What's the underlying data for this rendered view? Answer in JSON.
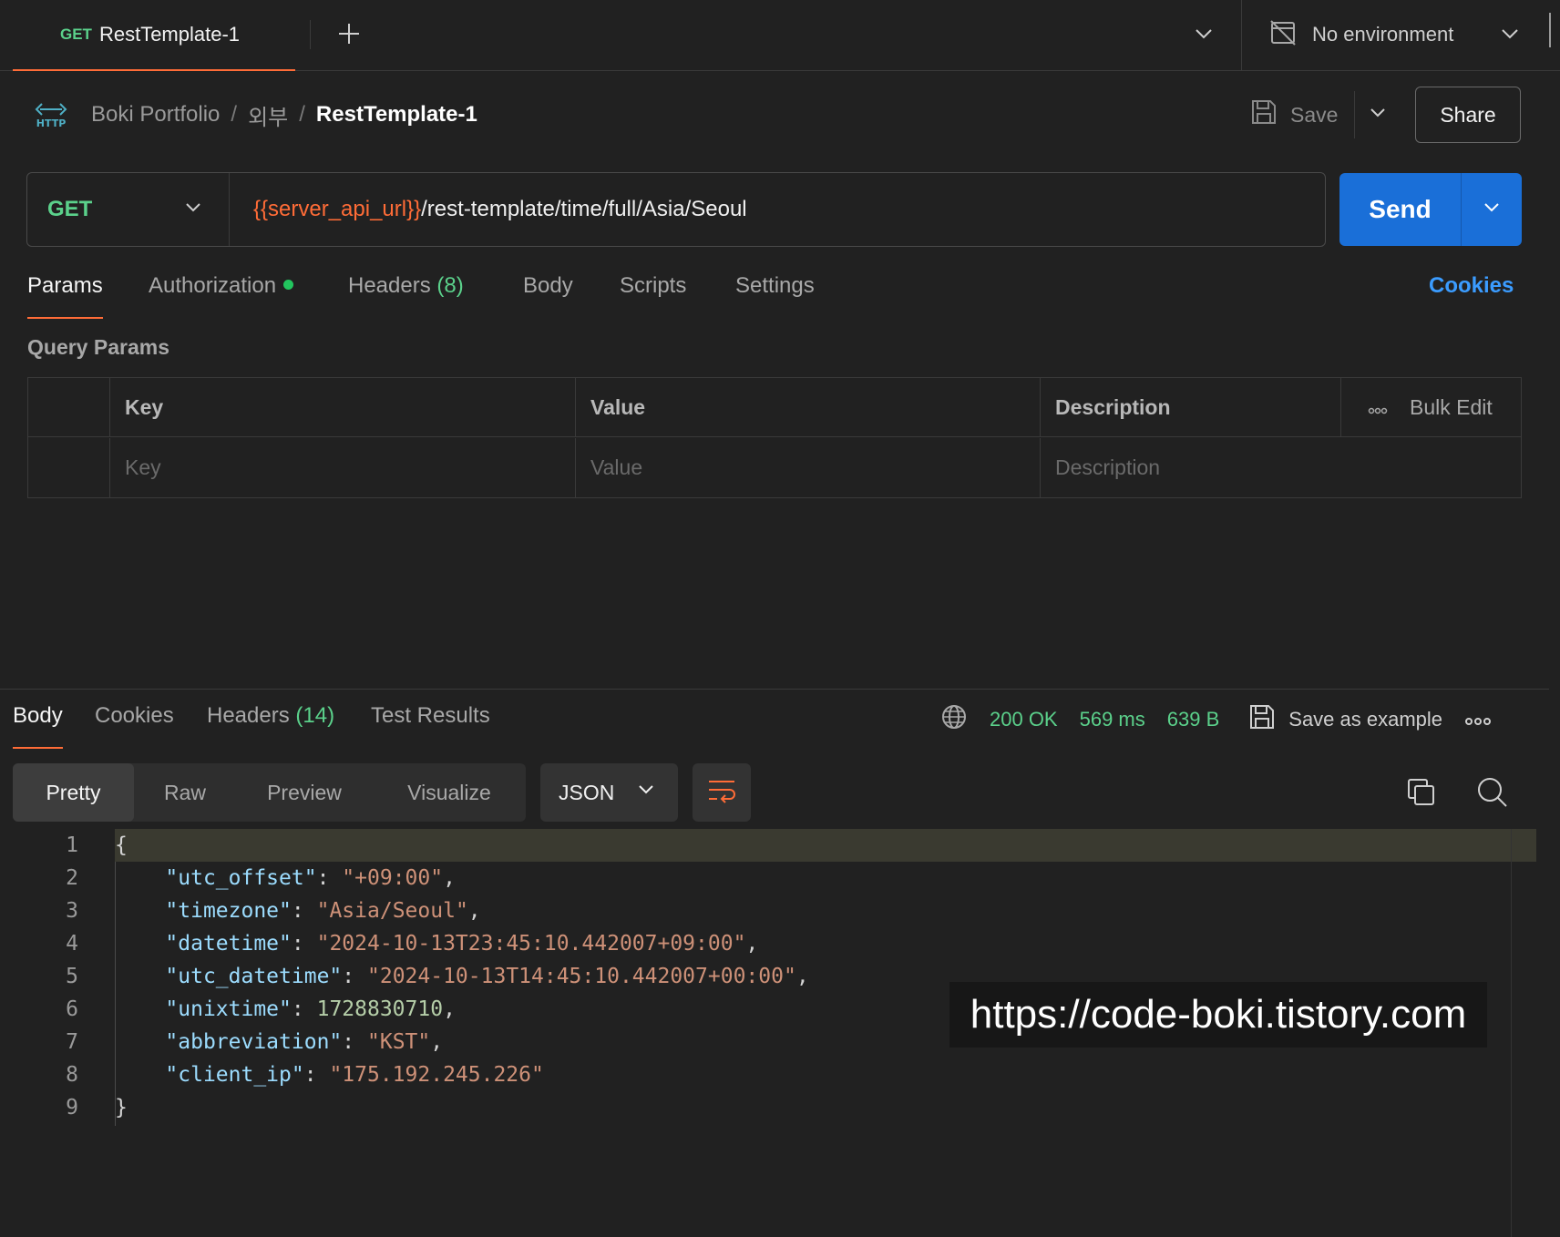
{
  "tab": {
    "method": "GET",
    "title": "RestTemplate-1"
  },
  "environment": {
    "label": "No environment"
  },
  "breadcrumb": {
    "collection": "Boki Portfolio",
    "folder": "외부",
    "request": "RestTemplate-1",
    "separator": "/"
  },
  "header": {
    "save_label": "Save",
    "share_label": "Share"
  },
  "request": {
    "method": "GET",
    "url_variable": "{{server_api_url}}",
    "url_path": "/rest-template/time/full/Asia/Seoul",
    "send_label": "Send"
  },
  "request_tabs": [
    {
      "label": "Params",
      "active": true
    },
    {
      "label": "Authorization",
      "status_dot": true
    },
    {
      "label": "Headers",
      "count": "(8)"
    },
    {
      "label": "Body"
    },
    {
      "label": "Scripts"
    },
    {
      "label": "Settings"
    }
  ],
  "cookies_link": "Cookies",
  "query_params": {
    "title": "Query Params",
    "columns": {
      "key": "Key",
      "value": "Value",
      "description": "Description"
    },
    "bulk_edit": "Bulk Edit",
    "placeholders": {
      "key": "Key",
      "value": "Value",
      "description": "Description"
    }
  },
  "response_tabs": [
    {
      "label": "Body",
      "active": true
    },
    {
      "label": "Cookies"
    },
    {
      "label": "Headers",
      "count": "(14)"
    },
    {
      "label": "Test Results"
    }
  ],
  "response_meta": {
    "status": "200 OK",
    "time": "569 ms",
    "size": "639 B",
    "save_example": "Save as example"
  },
  "view_modes": [
    "Pretty",
    "Raw",
    "Preview",
    "Visualize"
  ],
  "active_view_mode": "Pretty",
  "format": "JSON",
  "response_body": {
    "line_numbers": [
      "1",
      "2",
      "3",
      "4",
      "5",
      "6",
      "7",
      "8",
      "9"
    ],
    "open_brace": "{",
    "close_brace": "}",
    "fields": [
      {
        "key": "utc_offset",
        "value": "+09:00",
        "type": "string"
      },
      {
        "key": "timezone",
        "value": "Asia/Seoul",
        "type": "string"
      },
      {
        "key": "datetime",
        "value": "2024-10-13T23:45:10.442007+09:00",
        "type": "string"
      },
      {
        "key": "utc_datetime",
        "value": "2024-10-13T14:45:10.442007+00:00",
        "type": "string"
      },
      {
        "key": "unixtime",
        "value": "1728830710",
        "type": "number"
      },
      {
        "key": "abbreviation",
        "value": "KST",
        "type": "string"
      },
      {
        "key": "client_ip",
        "value": "175.192.245.226",
        "type": "string"
      }
    ]
  },
  "watermark": "https://code-boki.tistory.com",
  "colors": {
    "accent": "#ff6c37",
    "success": "#5bd18b",
    "primary": "#1a6fd8",
    "link": "#3b9cff",
    "background": "#212121"
  },
  "icons": {
    "request_type": "http-icon",
    "add_tab": "plus-icon",
    "environment": "no-environment-icon",
    "save": "save-icon",
    "network": "globe-icon",
    "more": "ellipsis-icon",
    "wrap": "wrap-lines-icon",
    "copy": "copy-icon",
    "search": "search-icon"
  }
}
